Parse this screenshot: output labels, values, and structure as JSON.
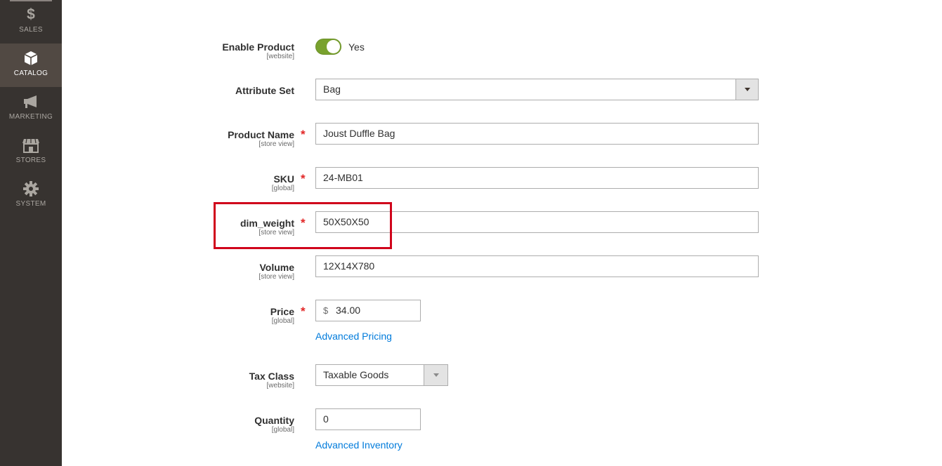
{
  "sidebar": {
    "items": [
      {
        "label": "SALES",
        "icon": "dollar-icon",
        "active": false
      },
      {
        "label": "CATALOG",
        "icon": "box-icon",
        "active": true
      },
      {
        "label": "MARKETING",
        "icon": "megaphone-icon",
        "active": false
      },
      {
        "label": "STORES",
        "icon": "store-icon",
        "active": false
      },
      {
        "label": "SYSTEM",
        "icon": "gear-icon",
        "active": false
      }
    ]
  },
  "form": {
    "enable_product": {
      "label": "Enable Product",
      "scope": "[website]",
      "value": "Yes",
      "checked": true
    },
    "attribute_set": {
      "label": "Attribute Set",
      "value": "Bag"
    },
    "product_name": {
      "label": "Product Name",
      "scope": "[store view]",
      "value": "Joust Duffle Bag",
      "required": "*"
    },
    "sku": {
      "label": "SKU",
      "scope": "[global]",
      "value": "24-MB01",
      "required": "*"
    },
    "dim_weight": {
      "label": "dim_weight",
      "scope": "[store view]",
      "value": "50X50X50",
      "required": "*"
    },
    "volume": {
      "label": "Volume",
      "scope": "[store view]",
      "value": "12X14X780"
    },
    "price": {
      "label": "Price",
      "scope": "[global]",
      "currency": "$",
      "value": "34.00",
      "required": "*",
      "link": "Advanced Pricing"
    },
    "tax_class": {
      "label": "Tax Class",
      "scope": "[website]",
      "value": "Taxable Goods"
    },
    "quantity": {
      "label": "Quantity",
      "scope": "[global]",
      "value": "0",
      "link": "Advanced Inventory"
    }
  },
  "colors": {
    "sidebar_bg": "#373330",
    "sidebar_active": "#514943",
    "toggle_on": "#79a22e",
    "required": "#e22626",
    "link": "#007bdb",
    "highlight": "#d0021b"
  }
}
